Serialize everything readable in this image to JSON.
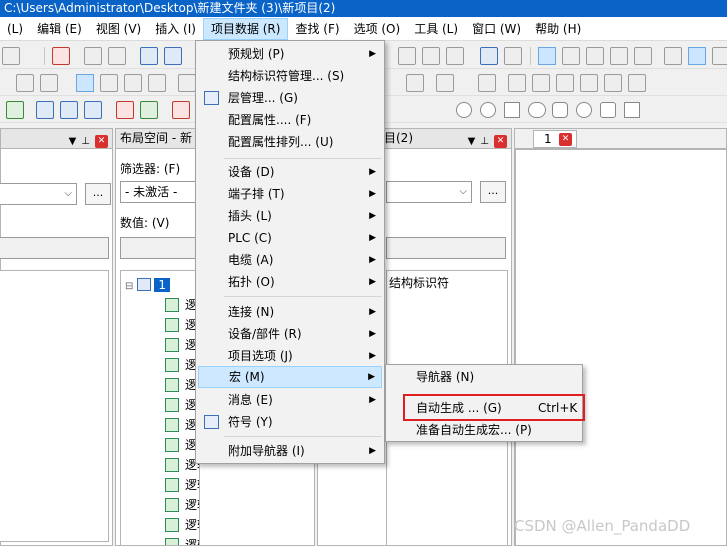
{
  "window": {
    "title": "C:\\Users\\Administrator\\Desktop\\新建文件夹 (3)\\新项目(2)"
  },
  "menubar": [
    "(L)",
    "编辑 (E)",
    "视图 (V)",
    "插入 (I)",
    "项目数据 (R)",
    "查找 (F)",
    "选项 (O)",
    "工具 (L)",
    "窗口 (W)",
    "帮助 (H)"
  ],
  "panels": {
    "left": {
      "title": ""
    },
    "middle": {
      "title": "布局空间 - 新",
      "filter_label": "筛选器: (F)",
      "filter_value": "- 未激活 -",
      "dots": "...",
      "value_label": "数值: (V)",
      "tree_root": "1",
      "tree_items": [
        "逻辑组件",
        "逻辑组件",
        "逻辑组件",
        "逻辑组件",
        "逻辑组件",
        "逻辑组件",
        "逻辑组件",
        "逻辑组件",
        "逻辑组件",
        "逻辑组件",
        "逻辑组件",
        "逻辑组件",
        "逻辑组件",
        "逻辑组件"
      ]
    },
    "right": {
      "title": "目(2)",
      "dots": "...",
      "tree_item": "结构标识符"
    }
  },
  "document_tab": {
    "label": "1"
  },
  "dropdown_menu": {
    "items": [
      {
        "label": "预规划 (P)",
        "submenu": true
      },
      {
        "label": "结构标识符管理... (S)",
        "submenu": false
      },
      {
        "label": "层管理... (G)",
        "submenu": false,
        "icon": "layer-icon"
      },
      {
        "label": "配置属性.... (F)",
        "submenu": false
      },
      {
        "label": "配置属性排列... (U)",
        "submenu": false
      },
      {
        "label": "设备 (D)",
        "submenu": true
      },
      {
        "label": "端子排 (T)",
        "submenu": true
      },
      {
        "label": "插头 (L)",
        "submenu": true
      },
      {
        "label": "PLC (C)",
        "submenu": true
      },
      {
        "label": "电缆 (A)",
        "submenu": true
      },
      {
        "label": "拓扑 (O)",
        "submenu": true
      },
      {
        "label": "连接 (N)",
        "submenu": true
      },
      {
        "label": "设备/部件 (R)",
        "submenu": true
      },
      {
        "label": "项目选项 (J)",
        "submenu": true
      },
      {
        "label": "宏 (M)",
        "submenu": true,
        "highlighted": true
      },
      {
        "label": "消息 (E)",
        "submenu": true
      },
      {
        "label": "符号 (Y)",
        "submenu": false,
        "icon": "symbol-icon"
      },
      {
        "label": "附加导航器 (I)",
        "submenu": true
      }
    ]
  },
  "submenu": {
    "items": [
      {
        "label": "导航器 (N)",
        "shortcut": ""
      },
      {
        "label": "自动生成 ... (G)",
        "shortcut": "Ctrl+K",
        "emphasized": true
      },
      {
        "label": "准备自动生成宏... (P)",
        "shortcut": ""
      }
    ]
  },
  "watermark": "CSDN @Allen_PandaDD",
  "colors": {
    "titlebar": "#0a64c8",
    "highlight": "#cde8ff",
    "redbox": "#e02020",
    "close": "#d9302f"
  }
}
